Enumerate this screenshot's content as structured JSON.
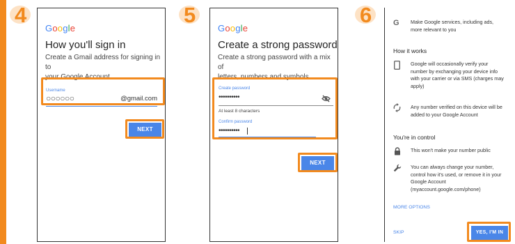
{
  "steps": [
    {
      "number": "4",
      "logo": "Google",
      "title": "How you'll sign in",
      "description_lines": [
        "Create a Gmail address for signing in to",
        "your Google Account"
      ],
      "username_label": "Username",
      "username_value": "○○○○○○",
      "username_suffix": "@gmail.com",
      "next_label": "NEXT"
    },
    {
      "number": "5",
      "logo": "Google",
      "title": "Create a strong password",
      "description_lines": [
        "Create a strong password with a mix of",
        "letters, numbers and symbols"
      ],
      "create_password_label": "Create password",
      "create_password_value": "••••••••••",
      "hint": "At least 8 characters",
      "confirm_password_label": "Confirm password",
      "confirm_password_value": "••••••••••",
      "next_label": "NEXT"
    },
    {
      "number": "6",
      "top_item_lines": [
        "Make Google services, including ads,",
        "more relevant to you"
      ],
      "how_it_works_heading": "How it works",
      "how_items": [
        {
          "icon": "phone-icon",
          "lines": [
            "Google will occasionally verify your",
            "number by exchanging your device info",
            "with your carrier or via SMS (charges may",
            "apply)"
          ]
        },
        {
          "icon": "sync-icon",
          "lines": [
            "Any number verified on this device will be",
            "added to your Google Account"
          ]
        }
      ],
      "control_heading": "You're in control",
      "control_items": [
        {
          "icon": "lock-icon",
          "lines": [
            "This won't make your number public"
          ]
        },
        {
          "icon": "wrench-icon",
          "lines": [
            "You can always change your number,",
            "control how it's used, or remove it in your",
            "Google Account",
            "(myaccount.google.com/phone)"
          ]
        }
      ],
      "more_options_label": "MORE OPTIONS",
      "skip_label": "SKIP",
      "yes_label": "YES, I'M IN"
    }
  ],
  "colors": {
    "accent_orange": "#f28a1e",
    "google_blue": "#4285f4",
    "button_blue": "#4a86e8"
  }
}
